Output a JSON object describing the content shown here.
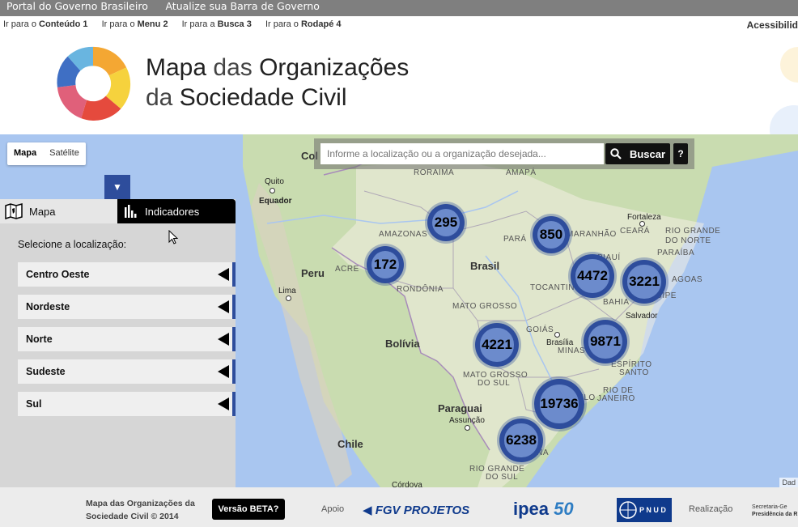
{
  "govbar": {
    "portal": "Portal do Governo Brasileiro",
    "atualize": "Atualize sua Barra de Governo"
  },
  "skiplinks": [
    {
      "prefix": "Ir para o ",
      "label": "Conteúdo",
      "key": "1"
    },
    {
      "prefix": "Ir para o ",
      "label": "Menu",
      "key": "2"
    },
    {
      "prefix": "Ir para a ",
      "label": "Busca",
      "key": "3"
    },
    {
      "prefix": "Ir para o ",
      "label": "Rodapé",
      "key": "4"
    }
  ],
  "accessibility": "Acessibilid",
  "header": {
    "title_line1_bold": "Mapa",
    "title_line1_light": " das ",
    "title_line1_end": "Organizações",
    "title_line2_light": "da ",
    "title_line2_bold": "Sociedade Civil"
  },
  "map": {
    "type_buttons": {
      "map": "Mapa",
      "satellite": "Satélite"
    },
    "search_placeholder": "Informe a localização ou a organização desejada...",
    "search_button": "Buscar",
    "help_button": "?",
    "attribution": "Dad",
    "labels": {
      "roraima": "RORAIMA",
      "amapa": "AMAPÁ",
      "amazonas": "AMAZONAS",
      "para": "PARÁ",
      "maranhao": "MARANHÃO",
      "ceara": "CEARÁ",
      "rgnorte": "RIO GRANDE",
      "rgnorte2": "DO NORTE",
      "paraiba": "PARAÍBA",
      "piaui": "PIAUÍ",
      "alagoas": "AGOAS",
      "acre": "ACRE",
      "rondonia": "RONDÔNIA",
      "tocantins": "TOCANTIN",
      "bahia": "BAHIA",
      "sergipe": "SERGIPE",
      "matogrosso": "MATO GROSSO",
      "goias": "GOIÁS",
      "minas": "MINAS GERAIS",
      "espirito1": "ESPÍRITO",
      "espirito2": "SANTO",
      "ms1": "MATO GROSSO",
      "ms2": "DO SUL",
      "riojaneiro1": "RIO DE",
      "riojaneiro2": "JANEIRO",
      "riogrande1": "RIO GRANDE",
      "riogrande2": "DO SUL",
      "santacatarina": "CATARINA",
      "saopaulo": "PAULO",
      "brasil": "Brasil",
      "peru": "Peru",
      "bolivia": "Bolívia",
      "paraguai": "Paraguai",
      "chile": "Chile",
      "quito": "Quito",
      "equador": "Equador",
      "lima": "Lima",
      "fortaleza": "Fortaleza",
      "salvador": "Salvador",
      "brasilia": "Brasília",
      "assuncao": "Assunção",
      "cordova": "Córdova",
      "col": "Col"
    },
    "clusters": [
      {
        "value": "295"
      },
      {
        "value": "850"
      },
      {
        "value": "172"
      },
      {
        "value": "4472"
      },
      {
        "value": "3221"
      },
      {
        "value": "4221"
      },
      {
        "value": "9871"
      },
      {
        "value": "19736"
      },
      {
        "value": "6238"
      }
    ]
  },
  "panel": {
    "tab_map": "Mapa",
    "tab_indicators": "Indicadores",
    "prompt": "Selecione a localização:",
    "regions": [
      "Centro Oeste",
      "Nordeste",
      "Norte",
      "Sudeste",
      "Sul"
    ]
  },
  "footer": {
    "site_line1": "Mapa das Organizações da",
    "site_line2": "Sociedade Civil © 2014",
    "beta": "Versão BETA?",
    "apoio": "Apoio",
    "fgv": "FGV PROJETOS",
    "ipea": "ipea",
    "ipea50": "50",
    "pnud": "P N U D",
    "realizacao": "Realização",
    "secretaria1": "Secretaria-Ge",
    "secretaria2": "Presidência da R"
  },
  "colors": {
    "cluster": "#2e4d9c",
    "ocean": "#a9c6f0",
    "land": "#c9dcb0",
    "brazil": "#f2efe4"
  }
}
